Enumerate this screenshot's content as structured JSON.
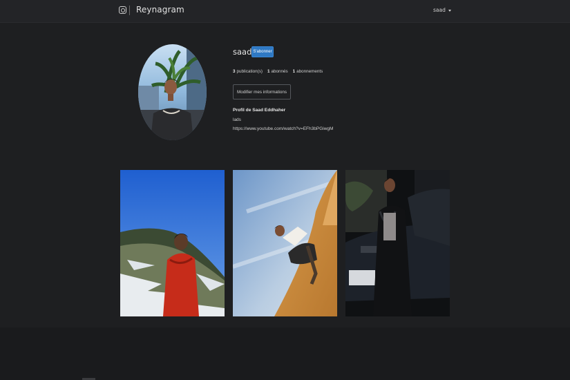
{
  "navbar": {
    "brand_icon": "instagram-icon",
    "brand_name": "Reynagram",
    "user_menu_label": "saad",
    "user_menu_icon": "caret-down-icon"
  },
  "profile": {
    "username": "saad",
    "follow_label": "S'abonner",
    "stats": {
      "publications_count": "3",
      "publications_label": "publication(s)",
      "followers_count": "1",
      "followers_label": "abonnés",
      "following_count": "1",
      "following_label": "abonnements"
    },
    "edit_label": "Modifier mes informations",
    "full_name": "Profil de Saad Eddhaher",
    "bio": "lads",
    "website": "https://www.youtube.com/watch?v=EFh3bPGiwgM"
  },
  "posts": [
    {
      "alt": "photo-mountain-red-jacket"
    },
    {
      "alt": "photo-desert-dune"
    },
    {
      "alt": "photo-night-car"
    }
  ],
  "colors": {
    "background": "#1e1f21",
    "navbar": "#232427",
    "accent": "#2f79c4"
  }
}
